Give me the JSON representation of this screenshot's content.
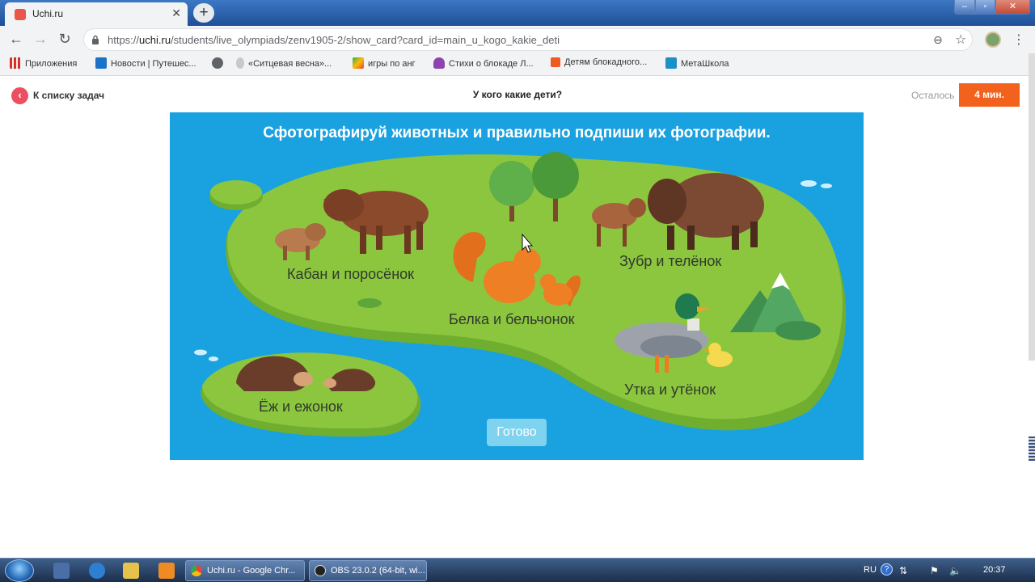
{
  "browser": {
    "tab_title": "Uchi.ru",
    "tab_close": "✕",
    "new_tab": "+",
    "url_prefix": "https://",
    "url_host": "uchi.ru",
    "url_path": "/students/live_olympiads/zenv1905-2/show_card?card_id=main_u_kogo_kakie_deti",
    "window_buttons": {
      "min": "–",
      "max": "▫",
      "close": "✕"
    }
  },
  "bookmarks": [
    {
      "label": "Приложения",
      "icon": "apps-icon",
      "color": "#d93025"
    },
    {
      "label": "Новости | Путешес...",
      "icon": "news-icon",
      "color": "#1a73c8"
    },
    {
      "label": "",
      "icon": "globe-icon",
      "color": "#5f6368"
    },
    {
      "label": "«Ситцевая весна»...",
      "icon": "flower-icon",
      "color": "#9aa0a6"
    },
    {
      "label": "игры по анг",
      "icon": "puzzle-icon",
      "color": "#34a853"
    },
    {
      "label": "Стихи о блокаде Л...",
      "icon": "butterfly-icon",
      "color": "#8e44ad"
    },
    {
      "label": "Детям блокадного...",
      "icon": "square-icon",
      "color": "#f05a22"
    },
    {
      "label": "МетаШкола",
      "icon": "metaschool-icon",
      "color": "#1e90c8"
    }
  ],
  "header": {
    "back_icon": "‹",
    "back_label": "К списку задач",
    "title": "У кого какие дети?",
    "time_left_label": "Осталось",
    "timer": "4 мин."
  },
  "task": {
    "instruction": "Сфотографируй животных и правильно подпиши их фотографии.",
    "labels": {
      "boar": "Кабан и поросёнок",
      "squirrel": "Белка и бельчонок",
      "bison": "Зубр и телёнок",
      "duck": "Утка и утёнок",
      "hedgehog": "Ёж и ежонок"
    },
    "done_button": "Готово",
    "colors": {
      "water": "#1aa1e0",
      "island": "#8cc63f",
      "island_edge": "#6fae2f",
      "button": "#7fd3ee"
    }
  },
  "taskbar": {
    "tasks": [
      {
        "label": "Uchi.ru - Google Chr..."
      },
      {
        "label": "OBS 23.0.2 (64-bit, wi..."
      }
    ],
    "lang": "RU",
    "help": "?",
    "clock": "20:37"
  }
}
